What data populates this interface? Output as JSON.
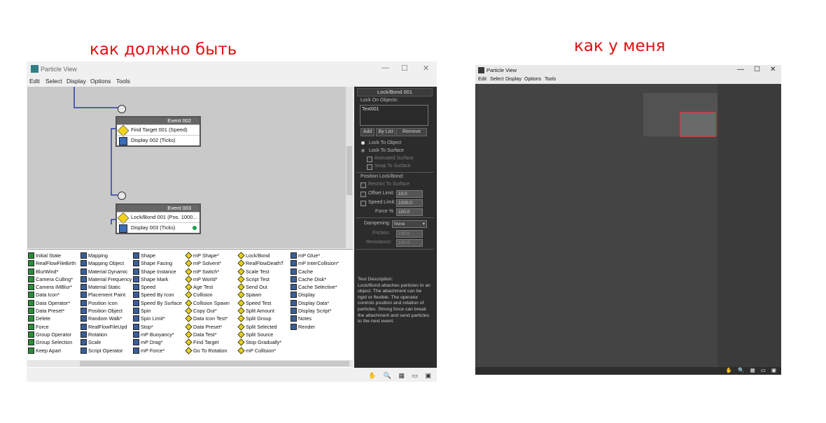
{
  "captions": {
    "left": "как должно быть",
    "right": "как у меня"
  },
  "window": {
    "title": "Particle View",
    "controls": [
      "—",
      "☐",
      "✕"
    ]
  },
  "menu": [
    "Edit",
    "Select",
    "Display",
    "Options",
    "Tools"
  ],
  "events": [
    {
      "header": "Event 002",
      "rows": [
        {
          "label": "Find Target 001 (Speed)",
          "icon": "test-icon"
        },
        {
          "label": "Display 002 (Ticks)",
          "icon": "display-icon"
        }
      ]
    },
    {
      "header": "Event 003",
      "rows": [
        {
          "label": "Lock/Bond 001 (Pos. 1000...",
          "icon": "test-icon"
        },
        {
          "label": "Display 003 (Ticks)",
          "icon": "display-icon"
        }
      ]
    }
  ],
  "depot": [
    [
      "Initial State",
      "RealFlowFileBirth",
      "BlurWind*",
      "Camera Culling*",
      "Camera IMBlur*",
      "Data Icon*",
      "Data Operator*",
      "Data Preset*",
      "Delete",
      "Force",
      "Group Operator",
      "Group Selection",
      "Keep Apart"
    ],
    [
      "Mapping",
      "Mapping Object",
      "Material Dynamic",
      "Material Frequency",
      "Material Static",
      "Placement Paint",
      "Position Icon",
      "Position Object",
      "Random Walk*",
      "RealFlowFileUpd",
      "Rotation",
      "Scale",
      "Script Operator"
    ],
    [
      "Shape",
      "Shape Facing",
      "Shape Instance",
      "Shape Mark",
      "Speed",
      "Speed By Icon",
      "Speed By Surface",
      "Spin",
      "Spin Limit*",
      "Stop*",
      "mP Buoyancy*",
      "mP Drag*",
      "mP Force*"
    ],
    [
      "mP Shape*",
      "mP Solvent*",
      "mP Switch*",
      "mP World*",
      "Age Test",
      "Collision",
      "Collision Spawn",
      "Copy Out*",
      "Data Icon Test*",
      "Data Preset*",
      "Data Test*",
      "Find Target",
      "Go To Rotation"
    ],
    [
      "Lock/Bond",
      "RealFlowDeathT",
      "Scale Test",
      "Script Test",
      "Send Out",
      "Spawn",
      "Speed Test",
      "Split Amount",
      "Split Group",
      "Split Selected",
      "Split Source",
      "Stop Gradually*",
      "mP Collision*"
    ],
    [
      "mP Glue*",
      "mP InterCollision*",
      "Cache",
      "Cache Disk*",
      "Cache Selective*",
      "Display",
      "Display Data*",
      "Display Script*",
      "Notes",
      "Render"
    ]
  ],
  "rollout": {
    "title": "Lock/Bond 001",
    "lock_on_label": "Lock On Objects:",
    "list_item": "Text001",
    "buttons": [
      "Add",
      "By List",
      "Remove"
    ],
    "radio_lock_object": "Lock To Object",
    "radio_lock_surface": "Lock To Surface",
    "animated_surface": "Animated Surface",
    "snap_to_surface": "Snap To Surface",
    "position_label": "Position Lock/Bond:",
    "restrict_to_surface": "Restrict To Surface",
    "offset_limit": "Offset Limit:",
    "offset_value": "10.0",
    "speed_limit": "Speed Limit:",
    "speed_value": "1000.0",
    "force_label": "Force %",
    "force_value": "100.0",
    "dampening_label": "Dampening:",
    "dampening_value": "None",
    "friction_label": "Friction:",
    "friction_value": "100.0",
    "resistance_label": "Resistance:",
    "resistance_value": "100.0",
    "desc_title": "Test Description:",
    "desc": "Lock/Bond attaches particles to an object. The attachment can be rigid or flexible. The operator controls position and rotation of particles. Strong force can break the attachment and send particles to the next event."
  },
  "statusbar_icons": "✋ 🔍 ▦ ▭ ▣"
}
